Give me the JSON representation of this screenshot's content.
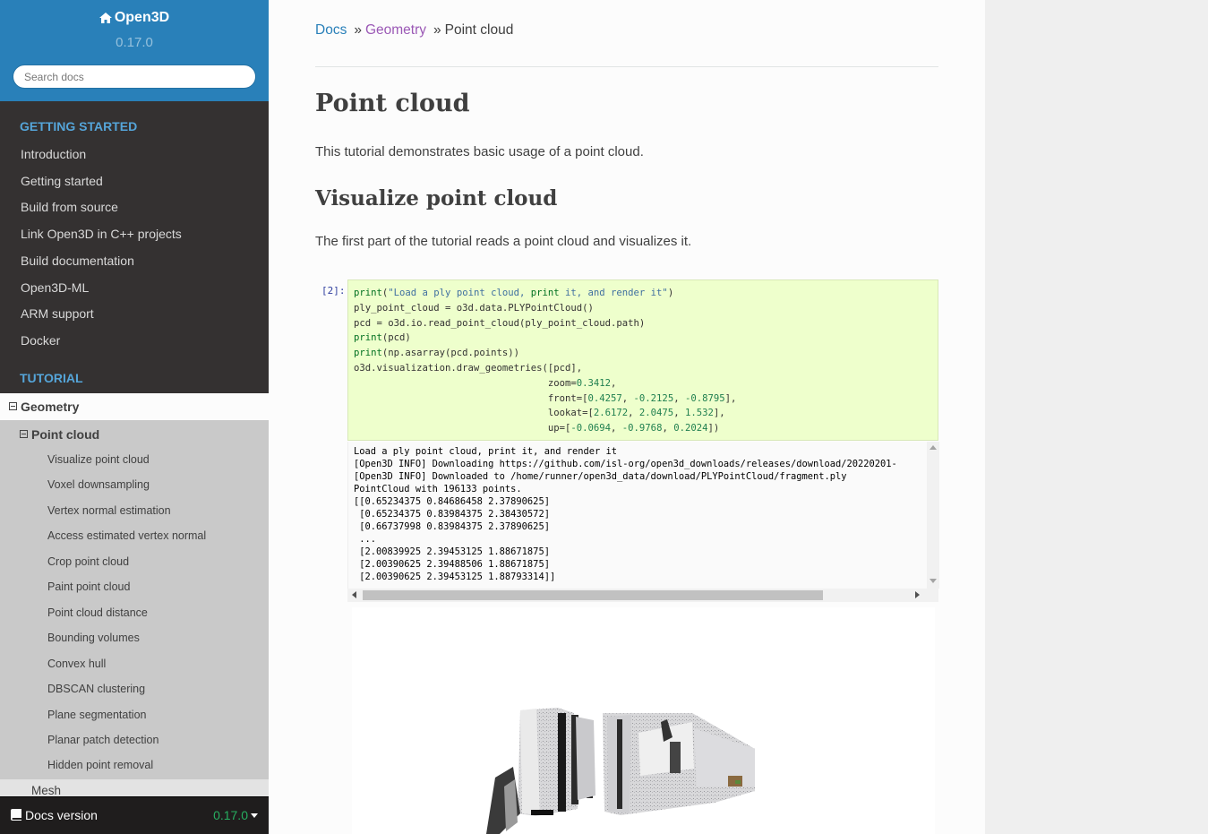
{
  "sidebar": {
    "project": "Open3D",
    "version": "0.17.0",
    "search_placeholder": "Search docs",
    "caption_getting_started": "GETTING STARTED",
    "getting_started_items": [
      "Introduction",
      "Getting started",
      "Build from source",
      "Link Open3D in C++ projects",
      "Build documentation",
      "Open3D-ML",
      "ARM support",
      "Docker"
    ],
    "caption_tutorial": "TUTORIAL",
    "current_section": "Geometry",
    "current_page": "Point cloud",
    "page_sections": [
      "Visualize point cloud",
      "Voxel downsampling",
      "Vertex normal estimation",
      "Access estimated vertex normal",
      "Crop point cloud",
      "Paint point cloud",
      "Point cloud distance",
      "Bounding volumes",
      "Convex hull",
      "DBSCAN clustering",
      "Plane segmentation",
      "Planar patch detection",
      "Hidden point removal"
    ],
    "next_item": "Mesh",
    "docs_version_label": "Docs version",
    "docs_version_value": "0.17.0"
  },
  "breadcrumb": {
    "docs": "Docs",
    "geometry": "Geometry",
    "current": "Point cloud",
    "sep": "»"
  },
  "page": {
    "title": "Point cloud",
    "intro": "This tutorial demonstrates basic usage of a point cloud.",
    "section_title": "Visualize point cloud",
    "section_text": "The first part of the tutorial reads a point cloud and visualizes it."
  },
  "cell": {
    "prompt": "[2]:",
    "code_lines": [
      "print(\"Load a ply point cloud, print it, and render it\")",
      "ply_point_cloud = o3d.data.PLYPointCloud()",
      "pcd = o3d.io.read_point_cloud(ply_point_cloud.path)",
      "print(pcd)",
      "print(np.asarray(pcd.points))",
      "o3d.visualization.draw_geometries([pcd],",
      "                                  zoom=0.3412,",
      "                                  front=[0.4257, -0.2125, -0.8795],",
      "                                  lookat=[2.6172, 2.0475, 1.532],",
      "                                  up=[-0.0694, -0.9768, 0.2024])"
    ],
    "output_lines": [
      "Load a ply point cloud, print it, and render it",
      "[Open3D INFO] Downloading https://github.com/isl-org/open3d_downloads/releases/download/20220201-",
      "[Open3D INFO] Downloaded to /home/runner/open3d_data/download/PLYPointCloud/fragment.ply",
      "PointCloud with 196133 points.",
      "[[0.65234375 0.84686458 2.37890625]",
      " [0.65234375 0.83984375 2.38430572]",
      " [0.66737998 0.83984375 2.37890625]",
      " ...",
      " [2.00839925 2.39453125 1.88671875]",
      " [2.00390625 2.39488506 1.88671875]",
      " [2.00390625 2.39453125 1.88793314]]"
    ]
  },
  "colors": {
    "sidebar_bg": "#343131",
    "header_blue": "#2980b9",
    "caption": "#55a5d9",
    "code_bg": "#eeffcc",
    "link": "#2980b9",
    "visited": "#9b59b6",
    "version_green": "#27ae60"
  }
}
